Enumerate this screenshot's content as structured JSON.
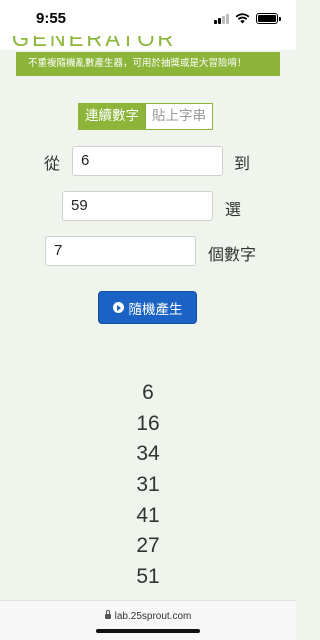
{
  "status_bar": {
    "time": "9:55",
    "signal": "cellular-signal-icon",
    "wifi": "wifi-icon",
    "battery": "battery-icon"
  },
  "header": {
    "title_fragment": "GENERATOR"
  },
  "banner": {
    "text": "不重複隨機亂數產生器，可用於抽獎或是大冒險唷！"
  },
  "tabs": [
    {
      "label": "連續數字",
      "active": true
    },
    {
      "label": "貼上字串",
      "active": false
    }
  ],
  "form": {
    "from_label": "從",
    "from_value": "6",
    "to_label": "到",
    "to_value": "59",
    "pick_label": "選",
    "count_value": "7",
    "count_label": "個數字"
  },
  "generate_button": {
    "label": "隨機產生",
    "icon": "play-circle-icon"
  },
  "results": [
    "6",
    "16",
    "34",
    "31",
    "41",
    "27",
    "51"
  ],
  "browser": {
    "url": "lab.25sprout.com",
    "lock_icon": "lock-icon"
  },
  "colors": {
    "accent_green": "#8cb53a",
    "button_blue": "#1a63c4",
    "page_bg": "#eff4ec"
  }
}
